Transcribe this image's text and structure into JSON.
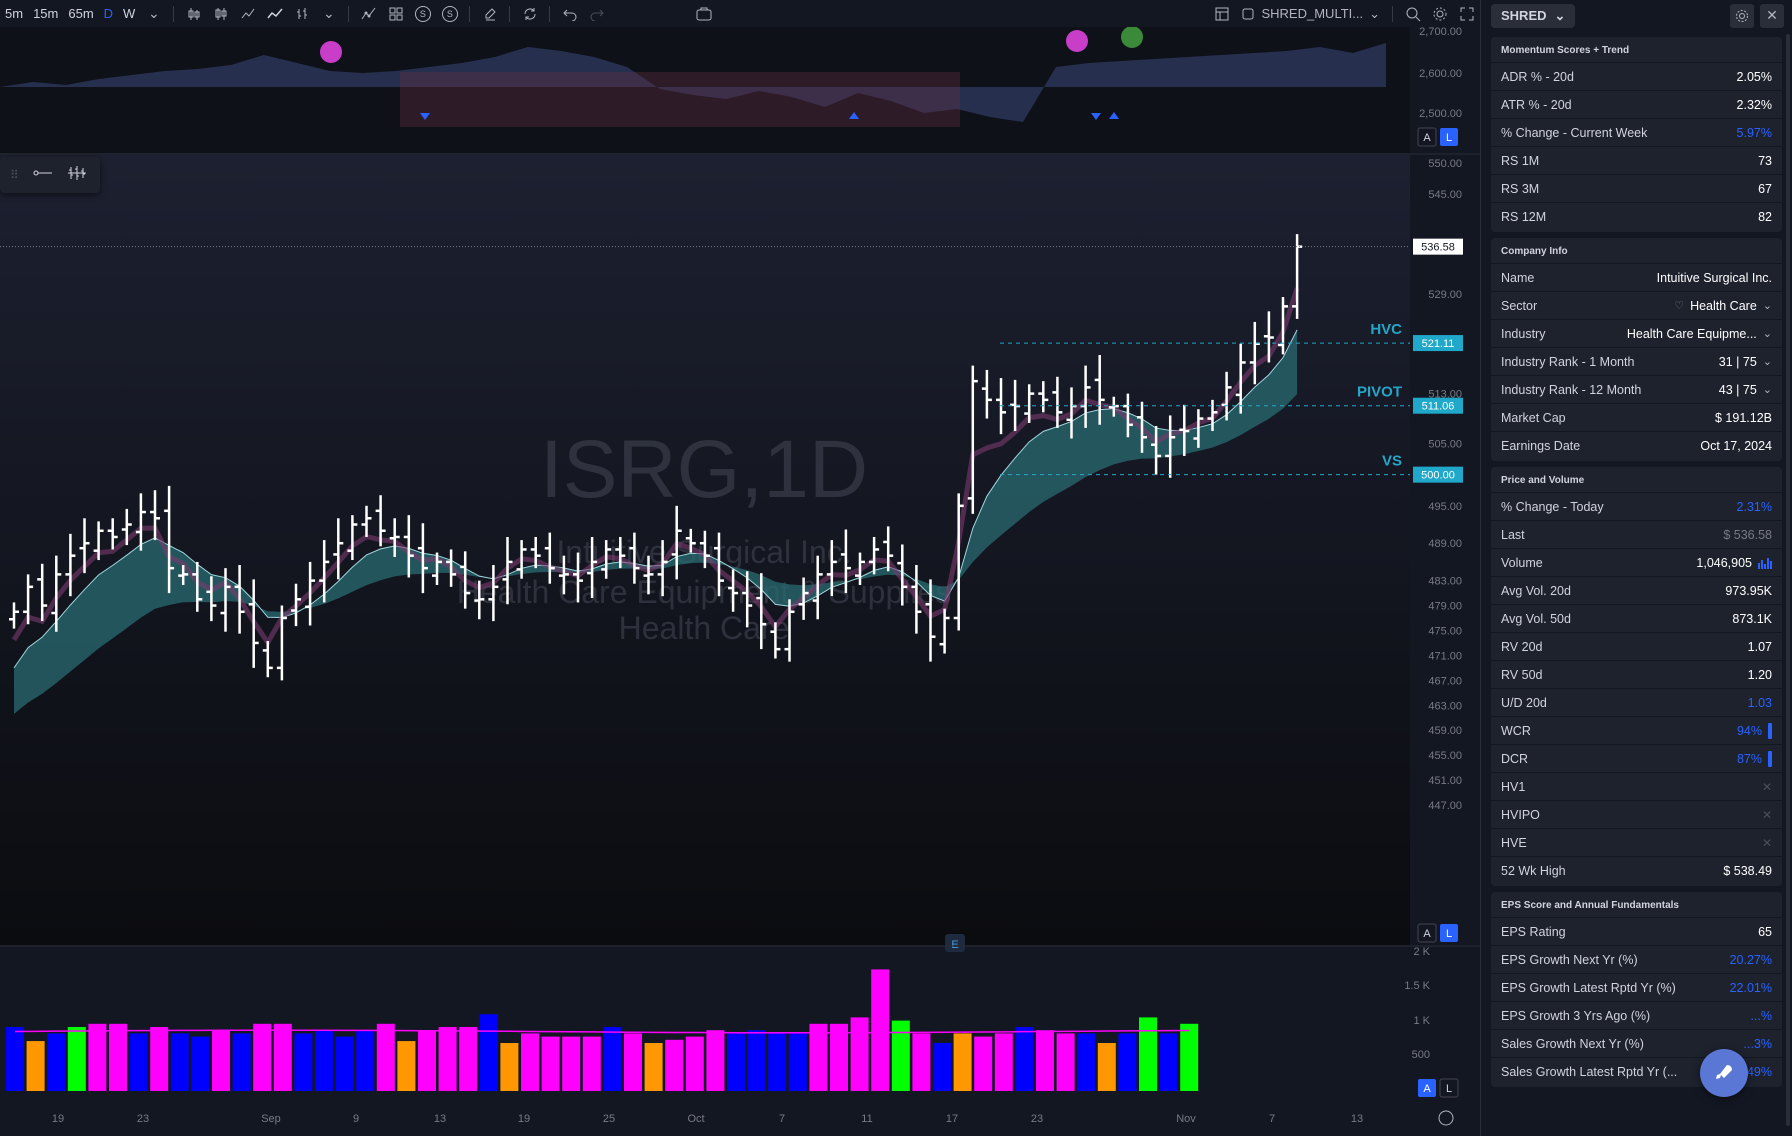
{
  "toolbar": {
    "timeframes": [
      "5m",
      "15m",
      "65m",
      "D",
      "W"
    ],
    "active_timeframe": "D",
    "s1": "S",
    "s2": "S",
    "layout_name": "SHRED_MULTI..."
  },
  "chart": {
    "watermark_symbol": "ISRG,1D",
    "watermark_name": "Intuitive Surgical Inc.",
    "watermark_industry": "Health Care Equipment & Supplies",
    "watermark_sector": "Health Care",
    "last_price_label": "536.58",
    "level_labels": [
      {
        "name": "HVC",
        "value": "521.11"
      },
      {
        "name": "PIVOT",
        "value": "511.06"
      },
      {
        "name": "VS",
        "value": "500.00"
      }
    ],
    "price_ticks": [
      "550.00",
      "545.00",
      "529.00",
      "513.00",
      "505.00",
      "495.00",
      "489.00",
      "483.00",
      "479.00",
      "475.00",
      "471.00",
      "467.00",
      "463.00",
      "459.00",
      "455.00",
      "451.00",
      "447.00"
    ],
    "upper_ticks": [
      "2,700.00",
      "2,600.00",
      "2,500.00"
    ],
    "volume_ticks": [
      "2 K",
      "1.5 K",
      "1 K",
      "500"
    ],
    "date_ticks": [
      "19",
      "23",
      "Sep",
      "9",
      "13",
      "19",
      "25",
      "Oct",
      "7",
      "11",
      "17",
      "23",
      "Nov",
      "7",
      "13"
    ],
    "earnings_marker": "E",
    "scale_buttons": [
      "A",
      "L"
    ]
  },
  "chart_data": {
    "type": "bar",
    "symbol": "ISRG",
    "interval": "1D",
    "price_range": [
      447,
      550
    ],
    "levels": {
      "HVC": 521.11,
      "PIVOT": 511.06,
      "VS": 500.0,
      "last": 536.58
    },
    "ohlc_close": [
      478,
      482,
      479,
      484,
      487,
      489,
      491,
      490,
      492,
      494,
      493,
      485,
      484,
      480,
      479,
      482,
      478,
      473,
      469,
      477,
      480,
      483,
      486,
      489,
      492,
      493,
      491,
      490,
      487,
      485,
      486,
      484,
      481,
      480,
      482,
      486,
      488,
      487,
      485,
      484,
      483,
      486,
      488,
      487,
      485,
      484,
      486,
      491,
      489,
      487,
      483,
      481,
      479,
      476,
      472,
      478,
      481,
      484,
      486,
      485,
      486,
      488,
      487,
      482,
      478,
      474,
      477,
      495,
      515,
      512,
      510,
      511,
      513,
      512,
      510,
      511,
      514,
      512,
      511,
      508,
      506,
      503,
      506,
      507,
      509,
      510,
      514,
      518,
      521,
      522,
      527,
      536.58
    ],
    "volume_range": [
      0,
      2000
    ],
    "volume_colors": {
      "up": "#ff00ff",
      "down": "#0000ff",
      "orange": "#ff9800",
      "green": "#00ff00"
    }
  },
  "panel": {
    "symbol_button": "SHRED",
    "sections": [
      {
        "title": "Momentum Scores + Trend",
        "rows": [
          {
            "label": "ADR % - 20d",
            "value": "2.05%",
            "style": ""
          },
          {
            "label": "ATR % - 20d",
            "value": "2.32%",
            "style": ""
          },
          {
            "label": "% Change - Current Week",
            "value": "5.97%",
            "style": "blue"
          },
          {
            "label": "RS 1M",
            "value": "73",
            "style": ""
          },
          {
            "label": "RS 3M",
            "value": "67",
            "style": ""
          },
          {
            "label": "RS 12M",
            "value": "82",
            "style": ""
          }
        ]
      },
      {
        "title": "Company Info",
        "rows": [
          {
            "label": "Name",
            "value": "Intuitive Surgical Inc.",
            "style": ""
          },
          {
            "label": "Sector",
            "value": "Health Care",
            "style": "",
            "icon": "heart-icon",
            "chev": true
          },
          {
            "label": "Industry",
            "value": "Health Care Equipme...",
            "style": "",
            "chev": true
          },
          {
            "label": "Industry Rank - 1 Month",
            "value": "31 | 75",
            "style": "",
            "chev": true
          },
          {
            "label": "Industry Rank - 12 Month",
            "value": "43 | 75",
            "style": "",
            "chev": true
          },
          {
            "label": "Market Cap",
            "value": "$ 191.12B",
            "style": ""
          },
          {
            "label": "Earnings Date",
            "value": "Oct 17, 2024",
            "style": ""
          }
        ]
      },
      {
        "title": "Price and Volume",
        "rows": [
          {
            "label": "% Change - Today",
            "value": "2.31%",
            "style": "blue"
          },
          {
            "label": "Last",
            "value": "$ 536.58",
            "style": "gray"
          },
          {
            "label": "Volume",
            "value": "1,046,905",
            "style": "",
            "volicon": true
          },
          {
            "label": "Avg Vol. 20d",
            "value": "973.95K",
            "style": ""
          },
          {
            "label": "Avg Vol. 50d",
            "value": "873.1K",
            "style": ""
          },
          {
            "label": "RV 20d",
            "value": "1.07",
            "style": ""
          },
          {
            "label": "RV 50d",
            "value": "1.20",
            "style": ""
          },
          {
            "label": "U/D 20d",
            "value": "1.03",
            "style": "blue"
          },
          {
            "label": "WCR",
            "value": "94%",
            "style": "blue",
            "bar": true
          },
          {
            "label": "DCR",
            "value": "87%",
            "style": "blue",
            "bar": true
          },
          {
            "label": "HV1",
            "value": "",
            "style": "",
            "x": true
          },
          {
            "label": "HVIPO",
            "value": "",
            "style": "",
            "x": true
          },
          {
            "label": "HVE",
            "value": "",
            "style": "",
            "x": true
          },
          {
            "label": "52 Wk High",
            "value": "$ 538.49",
            "style": ""
          }
        ]
      },
      {
        "title": "EPS Score and Annual Fundamentals",
        "rows": [
          {
            "label": "EPS Rating",
            "value": "65",
            "style": ""
          },
          {
            "label": "EPS Growth Next Yr (%)",
            "value": "20.27%",
            "style": "blue"
          },
          {
            "label": "EPS Growth Latest Rptd Yr (%)",
            "value": "22.01%",
            "style": "blue"
          },
          {
            "label": "EPS Growth 3 Yrs Ago (%)",
            "value": "...%",
            "style": "blue"
          },
          {
            "label": "Sales Growth Next Yr (%)",
            "value": "...3%",
            "style": "blue"
          },
          {
            "label": "Sales Growth Latest Rptd Yr (...",
            "value": "14.49%",
            "style": "blue"
          }
        ]
      }
    ]
  }
}
